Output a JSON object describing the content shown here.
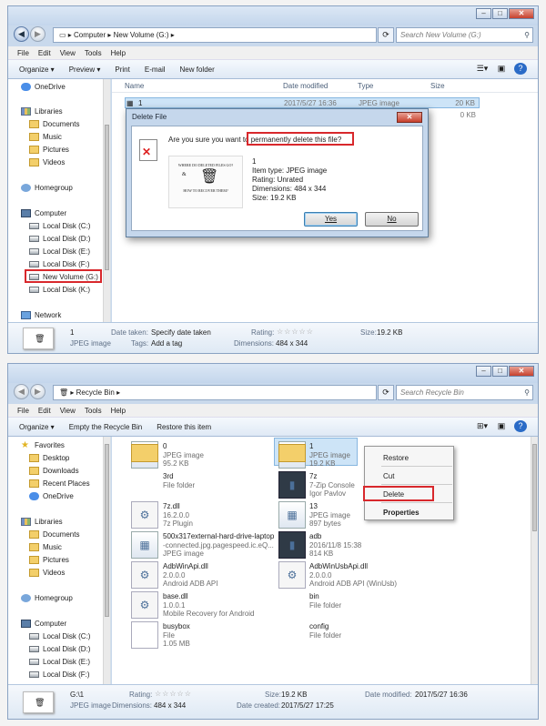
{
  "top": {
    "window_controls": [
      "–",
      "□",
      "✕"
    ],
    "address": {
      "path": [
        "Computer",
        "New Volume (G:)"
      ],
      "search_placeholder": "Search New Volume (G:)"
    },
    "menu": [
      "File",
      "Edit",
      "View",
      "Tools",
      "Help"
    ],
    "toolbar": [
      "Organize ▾",
      "Preview ▾",
      "Print",
      "E-mail",
      "New folder"
    ],
    "nav": [
      {
        "label": "OneDrive",
        "icon": "onedrive-icon"
      },
      {
        "label": "Libraries",
        "icon": "libraries-icon"
      },
      {
        "label": "Documents",
        "icon": "folder-icon"
      },
      {
        "label": "Music",
        "icon": "folder-icon"
      },
      {
        "label": "Pictures",
        "icon": "folder-icon"
      },
      {
        "label": "Videos",
        "icon": "folder-icon"
      },
      {
        "label": "Homegroup",
        "icon": "homegroup-icon"
      },
      {
        "label": "Computer",
        "icon": "computer-icon"
      },
      {
        "label": "Local Disk (C:)",
        "icon": "drive-icon"
      },
      {
        "label": "Local Disk (D:)",
        "icon": "drive-icon"
      },
      {
        "label": "Local Disk (E:)",
        "icon": "drive-icon"
      },
      {
        "label": "Local Disk (F:)",
        "icon": "drive-icon"
      },
      {
        "label": "New Volume (G:)",
        "icon": "drive-icon"
      },
      {
        "label": "Local Disk (K:)",
        "icon": "drive-icon"
      },
      {
        "label": "Network",
        "icon": "network-icon"
      }
    ],
    "columns": [
      "Name",
      "Date modified",
      "Type",
      "Size"
    ],
    "rows": [
      {
        "name": "1",
        "date": "2017/5/27 16:36",
        "type": "JPEG image",
        "size": "20 KB"
      },
      {
        "name": "",
        "date": "",
        "type": "",
        "size": "0 KB"
      }
    ],
    "details": {
      "name": "1",
      "type": "JPEG image",
      "date_taken_label": "Date taken:",
      "date_taken": "Specify date taken",
      "tags_label": "Tags:",
      "tags": "Add a tag",
      "rating_label": "Rating:",
      "rating": "☆☆☆☆☆",
      "dimensions_label": "Dimensions:",
      "dimensions": "484 x 344",
      "size_label": "Size:",
      "size": "19.2 KB"
    },
    "dialog": {
      "title": "Delete File",
      "close": "✕",
      "question_a": "Are you sure you want to ",
      "question_b": "permanently delete this file?",
      "thumb_line1": "WHERE DO DELETED FILES GO?",
      "thumb_amp": "&",
      "thumb_line2": "HOW TO RECOVER THEM?",
      "file_name": "1",
      "item_type": "Item type: JPEG image",
      "rating": "Rating: Unrated",
      "dimensions": "Dimensions: 484 x 344",
      "size": "Size: 19.2 KB",
      "yes": "Yes",
      "no": "No"
    }
  },
  "bottom": {
    "window_controls": [
      "–",
      "□",
      "✕"
    ],
    "address": {
      "path": [
        "Recycle Bin"
      ],
      "search_placeholder": "Search Recycle Bin"
    },
    "menu": [
      "File",
      "Edit",
      "View",
      "Tools",
      "Help"
    ],
    "toolbar": [
      "Organize ▾",
      "Empty the Recycle Bin",
      "Restore this item"
    ],
    "nav": [
      {
        "label": "Favorites",
        "icon": "star-icon"
      },
      {
        "label": "Desktop",
        "icon": "folder-icon"
      },
      {
        "label": "Downloads",
        "icon": "folder-icon"
      },
      {
        "label": "Recent Places",
        "icon": "folder-icon"
      },
      {
        "label": "OneDrive",
        "icon": "onedrive-icon"
      },
      {
        "label": "Libraries",
        "icon": "libraries-icon"
      },
      {
        "label": "Documents",
        "icon": "folder-icon"
      },
      {
        "label": "Music",
        "icon": "folder-icon"
      },
      {
        "label": "Pictures",
        "icon": "folder-icon"
      },
      {
        "label": "Videos",
        "icon": "folder-icon"
      },
      {
        "label": "Homegroup",
        "icon": "homegroup-icon"
      },
      {
        "label": "Computer",
        "icon": "computer-icon"
      },
      {
        "label": "Local Disk (C:)",
        "icon": "drive-icon"
      },
      {
        "label": "Local Disk (D:)",
        "icon": "drive-icon"
      },
      {
        "label": "Local Disk (E:)",
        "icon": "drive-icon"
      },
      {
        "label": "Local Disk (F:)",
        "icon": "drive-icon"
      }
    ],
    "items_left": [
      {
        "l1": "0",
        "l2": "JPEG image",
        "l3": "95.2 KB",
        "icon": "image-icon"
      },
      {
        "l1": "3rd",
        "l2": "File folder",
        "l3": "",
        "icon": "folder-icon"
      },
      {
        "l1": "7z.dll",
        "l2": "16.2.0.0",
        "l3": "7z Plugin",
        "icon": "dll-icon"
      },
      {
        "l1": "500x317external-hard-drive-laptop",
        "l2": "-connected.jpg.pagespeed.ic.eQ...",
        "l3": "JPEG image",
        "icon": "image-icon"
      },
      {
        "l1": "AdbWinApi.dll",
        "l2": "2.0.0.0",
        "l3": "Android ADB API",
        "icon": "dll-icon"
      },
      {
        "l1": "base.dll",
        "l2": "1.0.0.1",
        "l3": "Mobile Recovery for Android",
        "icon": "dll-icon"
      },
      {
        "l1": "busybox",
        "l2": "File",
        "l3": "1.05 MB",
        "icon": "file-icon"
      }
    ],
    "items_right": [
      {
        "l1": "1",
        "l2": "JPEG image",
        "l3": "19.2 KB",
        "icon": "image-icon"
      },
      {
        "l1": "7z",
        "l2": "7-Zip Console",
        "l3": "Igor Pavlov",
        "icon": "app-icon"
      },
      {
        "l1": "13",
        "l2": "JPEG image",
        "l3": "897 bytes",
        "icon": "image-icon"
      },
      {
        "l1": "adb",
        "l2": "2016/11/8 15:38",
        "l3": "814 KB",
        "icon": "app-icon"
      },
      {
        "l1": "AdbWinUsbApi.dll",
        "l2": "2.0.0.0",
        "l3": "Android ADB API (WinUsb)",
        "icon": "dll-icon"
      },
      {
        "l1": "bin",
        "l2": "File folder",
        "l3": "",
        "icon": "folder-icon"
      },
      {
        "l1": "config",
        "l2": "File folder",
        "l3": "",
        "icon": "folder-icon"
      }
    ],
    "context_menu": [
      "Restore",
      "Cut",
      "Delete",
      "Properties"
    ],
    "details": {
      "name": "G:\\1",
      "type": "JPEG image",
      "rating_label": "Rating:",
      "rating": "☆☆☆☆☆",
      "dimensions_label": "Dimensions:",
      "dimensions": "484 x 344",
      "size_label": "Size:",
      "size": "19.2 KB",
      "date_created_label": "Date created:",
      "date_created": "2017/5/27 17:25",
      "date_modified_label": "Date modified:",
      "date_modified": "2017/5/27 16:36"
    }
  },
  "colors": {
    "highlight": "#d8282c",
    "selection": "#cde4f7",
    "accent": "#2a6bc7"
  }
}
